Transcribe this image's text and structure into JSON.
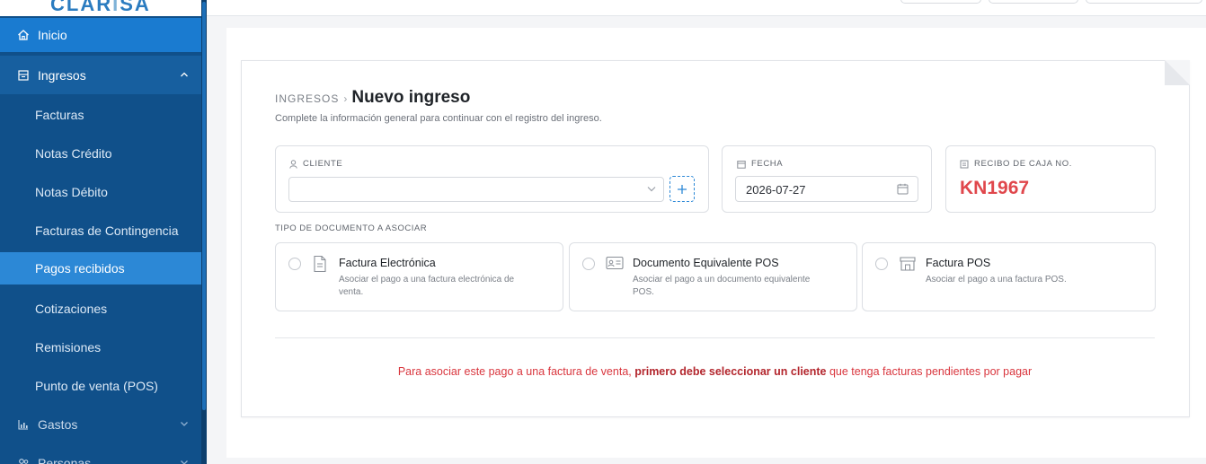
{
  "brand": {
    "logo_main": "CLAR",
    "logo_accent": "I",
    "logo_end": "SA"
  },
  "sidebar": {
    "items": [
      {
        "label": "Inicio",
        "icon": "home-icon"
      },
      {
        "label": "Ingresos",
        "icon": "register-icon",
        "expanded": true
      },
      {
        "label": "Facturas"
      },
      {
        "label": "Notas Crédito"
      },
      {
        "label": "Notas Débito"
      },
      {
        "label": "Facturas de Contingencia"
      },
      {
        "label": "Pagos recibidos",
        "active": true
      },
      {
        "label": "Cotizaciones"
      },
      {
        "label": "Remisiones"
      },
      {
        "label": "Punto de venta (POS)"
      },
      {
        "label": "Gastos",
        "icon": "bar-chart-icon"
      },
      {
        "label": "Personas",
        "icon": "people-icon"
      }
    ]
  },
  "page": {
    "breadcrumb": "INGRESOS",
    "title": "Nuevo ingreso",
    "subtitle": "Complete la información general para continuar con el registro del ingreso."
  },
  "form": {
    "cliente_label": "CLIENTE",
    "cliente_value": "",
    "fecha_label": "FECHA",
    "fecha_value": "2026-07-27",
    "recibo_label": "RECIBO DE CAJA NO.",
    "recibo_value": "KN1967",
    "tipo_label": "TIPO DE DOCUMENTO A ASOCIAR"
  },
  "options": [
    {
      "title": "Factura Electrónica",
      "desc_line1": "Asociar el pago a una factura electrónica de",
      "desc_line2": "venta."
    },
    {
      "title": "Documento Equivalente POS",
      "desc_line1": "Asociar el pago a un documento equivalente",
      "desc_line2": "POS."
    },
    {
      "title": "Factura POS",
      "desc_line1": "Asociar el pago a una factura POS.",
      "desc_line2": ""
    }
  ],
  "notice": {
    "part1": "Para asociar este pago a una factura de venta, ",
    "bold": "primero debe seleccionar un cliente",
    "part2": " que tenga facturas pendientes por pagar"
  },
  "colors": {
    "sidebar": "#10508a",
    "active": "#2c88d6",
    "accent_red": "#e0474c",
    "link_blue": "#2c88d6"
  }
}
